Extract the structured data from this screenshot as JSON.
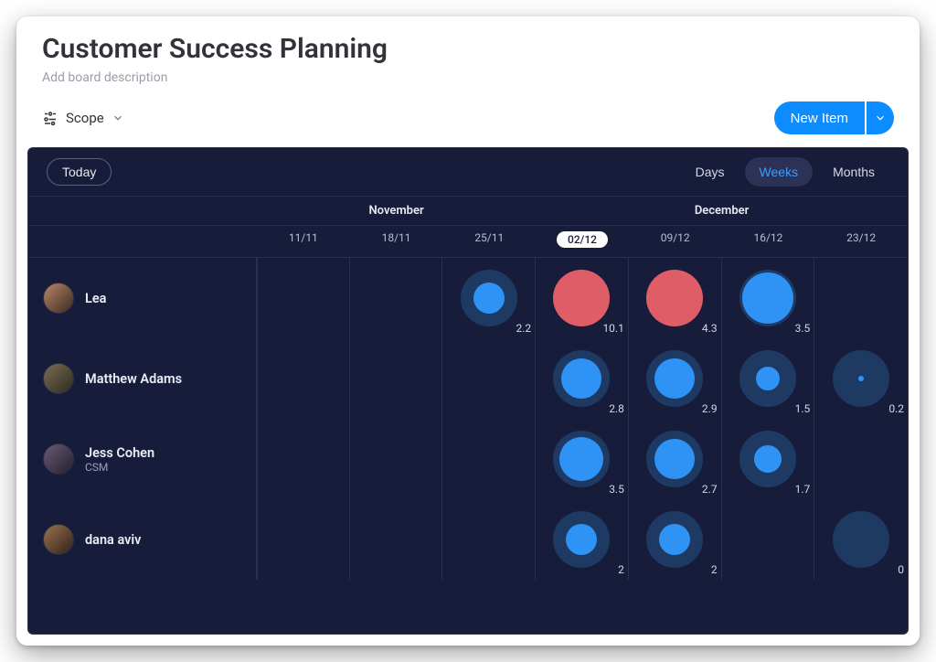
{
  "header": {
    "title": "Customer Success Planning",
    "subtitle_placeholder": "Add board description"
  },
  "toolbar": {
    "scope_label": "Scope",
    "new_item_label": "New Item"
  },
  "panel": {
    "today_label": "Today",
    "ranges": {
      "days": "Days",
      "weeks": "Weeks",
      "months": "Months"
    },
    "active_range": "weeks",
    "months": {
      "left": "November",
      "right": "December"
    },
    "dates": [
      "11/11",
      "18/11",
      "25/11",
      "02/12",
      "09/12",
      "16/12",
      "23/12"
    ],
    "current_date_index": 3
  },
  "people": [
    {
      "name": "Lea",
      "role": ""
    },
    {
      "name": "Matthew Adams",
      "role": ""
    },
    {
      "name": "Jess Cohen",
      "role": "CSM"
    },
    {
      "name": "dana aviv",
      "role": ""
    }
  ],
  "chart_data": {
    "type": "table",
    "columns": [
      "11/11",
      "18/11",
      "25/11",
      "02/12",
      "09/12",
      "16/12",
      "23/12"
    ],
    "colors": {
      "blue": "#2f93f6",
      "red": "#df5d66",
      "ring": "#1e3a63"
    },
    "rows": [
      {
        "name": "Lea",
        "cells": [
          null,
          null,
          {
            "v": 2.2,
            "c": "blue",
            "s": 34
          },
          {
            "v": 10.1,
            "c": "red",
            "s": 62
          },
          {
            "v": 4.3,
            "c": "red",
            "s": 62
          },
          {
            "v": 3.5,
            "c": "blue",
            "s": 56
          },
          null
        ]
      },
      {
        "name": "Matthew Adams",
        "cells": [
          null,
          null,
          null,
          {
            "v": 2.8,
            "c": "blue",
            "s": 44
          },
          {
            "v": 2.9,
            "c": "blue",
            "s": 44
          },
          {
            "v": 1.5,
            "c": "blue",
            "s": 26
          },
          {
            "v": 0.2,
            "c": "blue",
            "s": 6
          }
        ]
      },
      {
        "name": "Jess Cohen",
        "cells": [
          null,
          null,
          null,
          {
            "v": 3.5,
            "c": "blue",
            "s": 48
          },
          {
            "v": 2.7,
            "c": "blue",
            "s": 44
          },
          {
            "v": 1.7,
            "c": "blue",
            "s": 30
          },
          null
        ]
      },
      {
        "name": "dana aviv",
        "cells": [
          null,
          null,
          null,
          {
            "v": 2,
            "c": "blue",
            "s": 34
          },
          {
            "v": 2,
            "c": "blue",
            "s": 34
          },
          null,
          {
            "v": 0,
            "c": "blue",
            "s": 0
          }
        ]
      }
    ]
  }
}
